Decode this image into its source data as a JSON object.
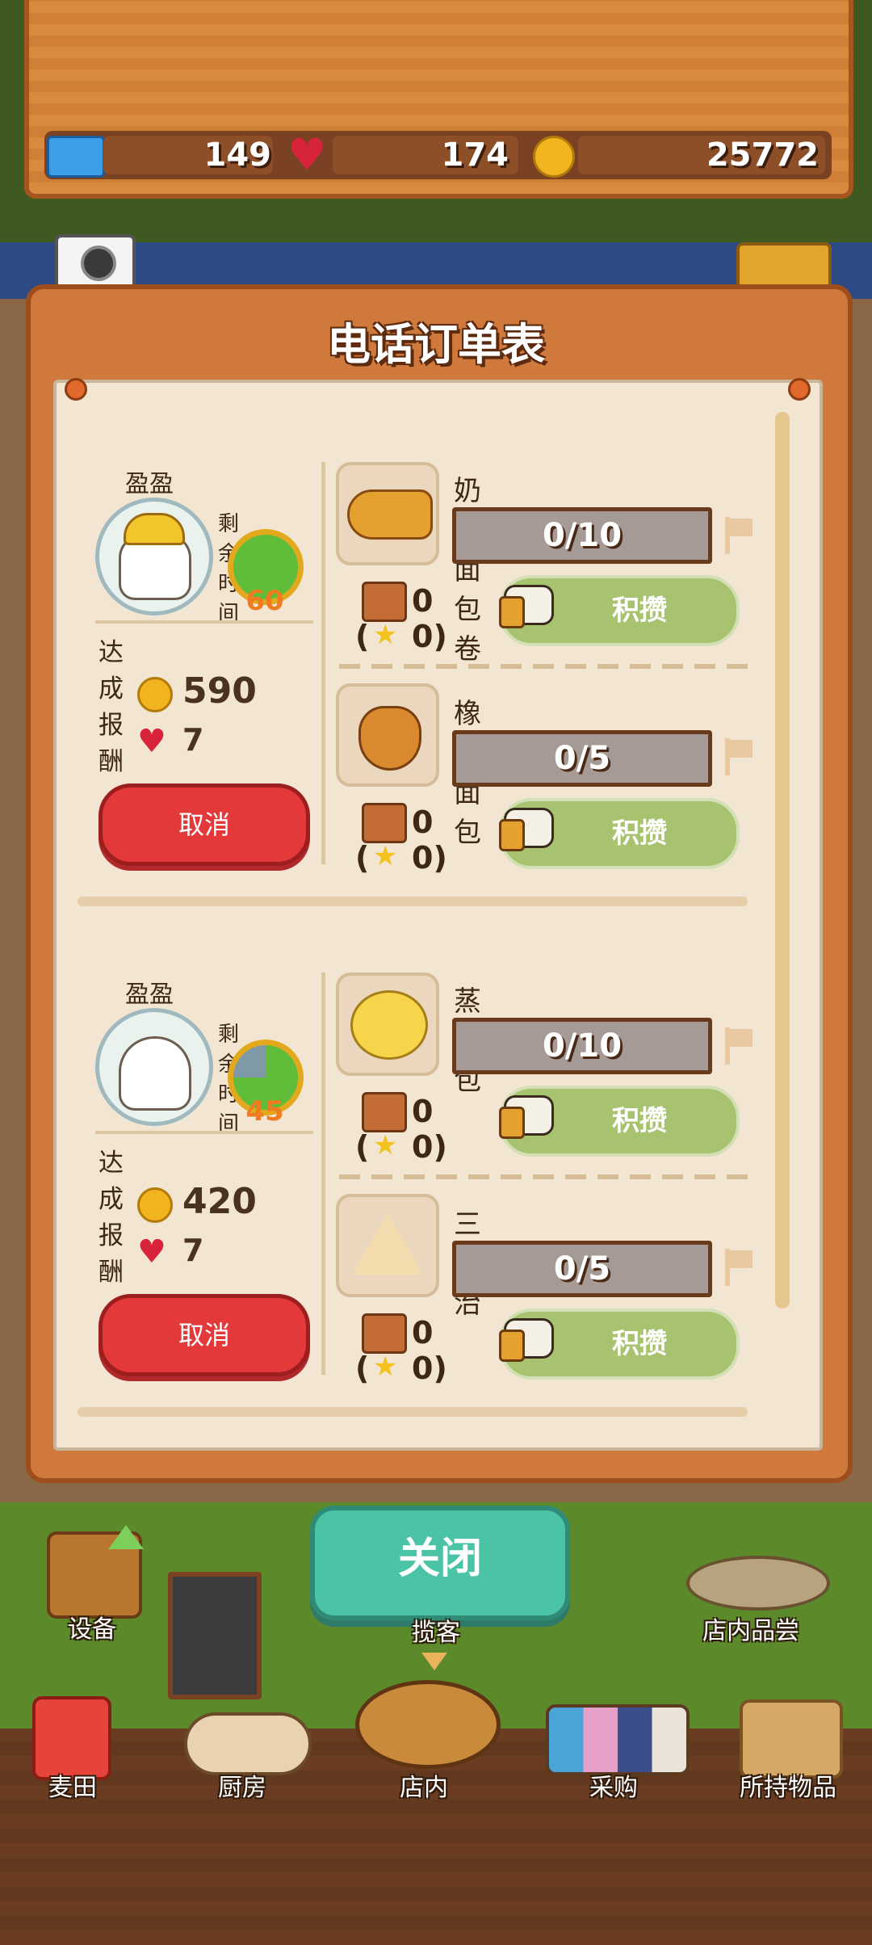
{
  "header": {
    "tickets": "149",
    "hearts": "174",
    "coins": "25772"
  },
  "camera_label": "照相",
  "panel": {
    "title": "电话订单表"
  },
  "orders": [
    {
      "customer": "盈盈",
      "time_label": "剩余时间",
      "time_left": "60",
      "reward_label": "达成报酬",
      "reward_coins": "590",
      "reward_hearts": "7",
      "cancel_label": "取消",
      "items": [
        {
          "name": "奶油面包卷",
          "progress": "0/10",
          "stock": "0",
          "star_stock": "(",
          "star_qty": "0)",
          "stock_label": "积攒"
        },
        {
          "name": "橡子面包",
          "progress": "0/5",
          "stock": "0",
          "star_stock": "(",
          "star_qty": "0)",
          "stock_label": "积攒"
        }
      ]
    },
    {
      "customer": "盈盈",
      "time_label": "剩余时间",
      "time_left": "45",
      "reward_label": "达成报酬",
      "reward_coins": "420",
      "reward_hearts": "7",
      "cancel_label": "取消",
      "items": [
        {
          "name": "蒸面包",
          "progress": "0/10",
          "stock": "0",
          "star_stock": "(",
          "star_qty": "0)",
          "stock_label": "积攒"
        },
        {
          "name": "三明治",
          "progress": "0/5",
          "stock": "0",
          "star_stock": "(",
          "star_qty": "0)",
          "stock_label": "积攒"
        }
      ]
    }
  ],
  "close_label": "关闭",
  "shop_actions": {
    "equipment": "设备",
    "attract": "揽客",
    "tasting": "店内品尝"
  },
  "nav": {
    "field": "麦田",
    "kitchen": "厨房",
    "store": "店内",
    "purchase": "采购",
    "inventory": "所持物品"
  }
}
